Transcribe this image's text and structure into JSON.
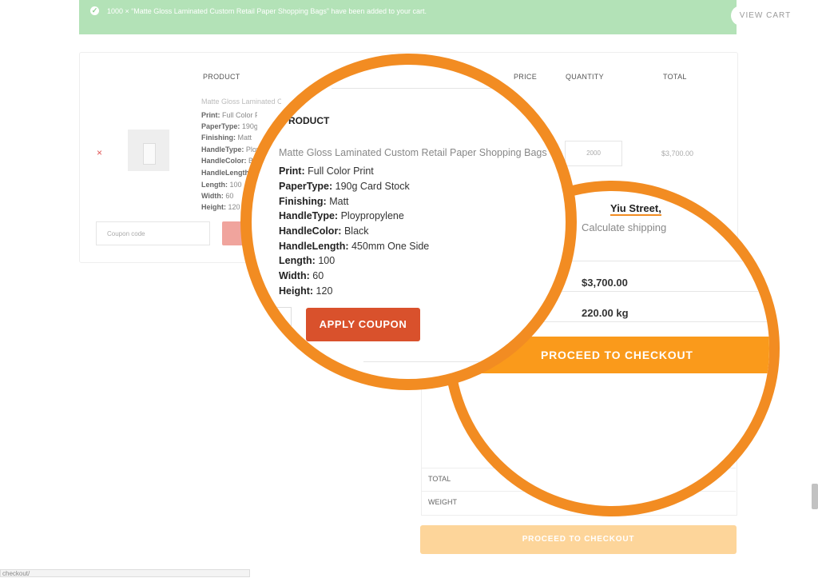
{
  "notice": {
    "message": "1000 × “Matte Gloss Laminated Custom Retail Paper Shopping Bags” have been added to your cart.",
    "view_cart": "VIEW CART"
  },
  "cart": {
    "headers": {
      "product": "PRODUCT",
      "price": "PRICE",
      "quantity": "QUANTITY",
      "total": "TOTAL"
    },
    "item": {
      "remove": "×",
      "name": "Matte Gloss Laminated Custom Retail Paper Shopping Bags",
      "specs": [
        {
          "label": "Print:",
          "value": "Full Color Print"
        },
        {
          "label": "PaperType:",
          "value": "190g Card Stock"
        },
        {
          "label": "Finishing:",
          "value": "Matt"
        },
        {
          "label": "HandleType:",
          "value": "Ploypropylene"
        },
        {
          "label": "HandleColor:",
          "value": "Black"
        },
        {
          "label": "HandleLength:",
          "value": "450mm One Side"
        },
        {
          "label": "Length:",
          "value": "100"
        },
        {
          "label": "Width:",
          "value": "60"
        },
        {
          "label": "Height:",
          "value": "120"
        }
      ],
      "quantity": "2000",
      "total": "$3,700.00"
    },
    "coupon_placeholder": "Coupon code",
    "apply_coupon": "APPLY COUPON"
  },
  "totals": {
    "street": "Yiu Street,",
    "calculate_shipping": "Calculate shipping",
    "total_label": "TOTAL",
    "weight_label": "WEIGHT",
    "total_value": "$3,700.00",
    "weight_value": "220.00 kg",
    "proceed": "PROCEED TO CHECKOUT"
  },
  "status_url": "checkout/"
}
